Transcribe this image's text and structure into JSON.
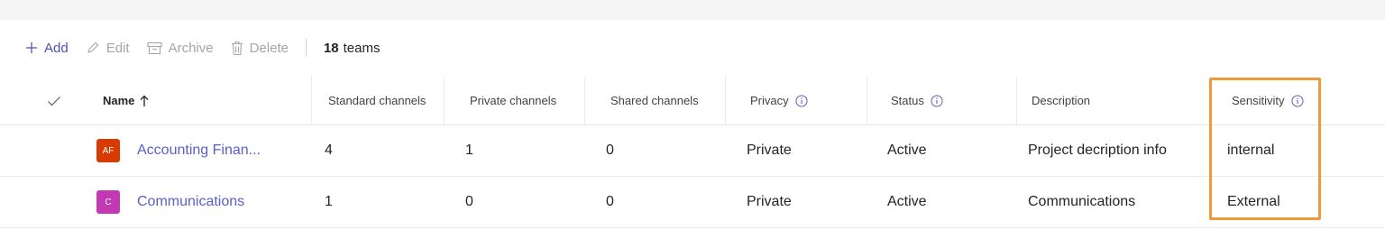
{
  "toolbar": {
    "add_label": "Add",
    "edit_label": "Edit",
    "archive_label": "Archive",
    "delete_label": "Delete",
    "team_count_number": "18",
    "team_count_label": "teams"
  },
  "table": {
    "columns": {
      "name": "Name",
      "standard_channels": "Standard channels",
      "private_channels": "Private channels",
      "shared_channels": "Shared channels",
      "privacy": "Privacy",
      "status": "Status",
      "description": "Description",
      "sensitivity": "Sensitivity"
    },
    "rows": [
      {
        "avatar_initials": "AF",
        "avatar_color": "#d83b01",
        "name": "Accounting Finan...",
        "standard_channels": "4",
        "private_channels": "1",
        "shared_channels": "0",
        "privacy": "Private",
        "status": "Active",
        "description": "Project decription info",
        "sensitivity": "internal"
      },
      {
        "avatar_initials": "C",
        "avatar_color": "#c239b3",
        "name": "Communications",
        "standard_channels": "1",
        "private_channels": "0",
        "shared_channels": "0",
        "privacy": "Private",
        "status": "Active",
        "description": "Communications",
        "sensitivity": "External"
      }
    ]
  },
  "colors": {
    "accent": "#5b5fc7",
    "highlight": "#f0983a"
  }
}
